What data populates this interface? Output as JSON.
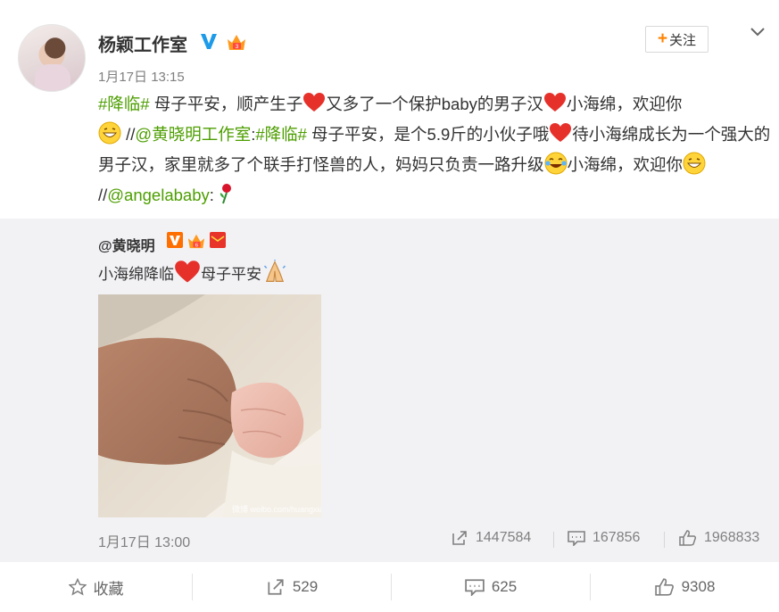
{
  "post": {
    "author": "杨颖工作室",
    "follow_label": "关注",
    "time": "1月17日 13:15",
    "text": {
      "tag1": "#降临#",
      "seg1": " 母子平安，顺产生子",
      "seg2": "又多了一个保护baby的男子汉",
      "seg3": "小海绵，欢迎你",
      "seg4": " //",
      "mention1": "@黄晓明工作室",
      "seg5": ":",
      "tag2": "#降临#",
      "seg6": " 母子平安，是个5.9斤的小伙子哦",
      "seg7": "待小海绵成长为一个强大的男子汉，家里就多了个联手打怪兽的人，妈妈只负责一路升级",
      "seg8": "小海绵，欢迎你",
      "seg9": " //",
      "mention2": "@angelababy",
      "seg10": ":"
    }
  },
  "retweet": {
    "author": "@黄晓明",
    "text_a": "小海绵降临",
    "text_b": "母子平安",
    "photo_watermark": "微博  weibo.com/huangxiaoming",
    "time": "1月17日 13:00",
    "reposts": "1447584",
    "comments": "167856",
    "likes": "1968833"
  },
  "actions": {
    "favorite": "收藏",
    "repost": "529",
    "comment": "625",
    "like": "9308"
  },
  "colors": {
    "link_green": "#4d9e00",
    "accent_orange": "#ff8200",
    "retweet_bg": "#f2f2f5"
  },
  "icons": [
    "verified-v-icon",
    "crown-badge-icon",
    "chevron-down-icon",
    "heart-emoji-icon",
    "grin-emoji-icon",
    "laugh-tears-emoji-icon",
    "rose-emoji-icon",
    "red-envelope-icon",
    "pray-emoji-icon",
    "repost-icon",
    "comment-icon",
    "thumbs-up-icon",
    "star-icon"
  ]
}
